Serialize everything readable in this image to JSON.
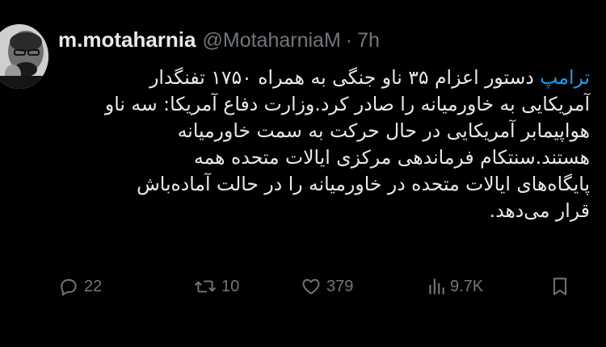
{
  "tweet": {
    "display_name": "m.motaharnia",
    "handle": "@MotaharniaM",
    "separator": "·",
    "time": "7h",
    "mention": "ترامپ",
    "lines": [
      "دستور اعزام ۳۵ ناو جنگی به همراه ۱۷۵۰ تفنگدار",
      "آمریکایی به خاورمیانه را صادر کرد.وزارت دفاع آمریکا: سه ناو",
      "هواپیمابر آمریکایی در حال حرکت به سمت خاورمیانه",
      "هستند.سنتکام فرماندهی مرکزی ایالات متحده همه",
      "پایگاه‌های ایالات متحده در خاورمیانه را در حالت آماده‌باش",
      "قرار می‌دهد."
    ],
    "actions": {
      "reply_icon": "reply-icon",
      "replies": "22",
      "retweet_icon": "retweet-icon",
      "retweets": "10",
      "like_icon": "heart-icon",
      "likes": "379",
      "views_icon": "views-icon",
      "views": "9.7K",
      "bookmark_icon": "bookmark-icon"
    },
    "colors": {
      "background": "#000000",
      "text": "#e7e9ea",
      "secondary": "#71767b",
      "mention": "#1d9bf0"
    }
  }
}
